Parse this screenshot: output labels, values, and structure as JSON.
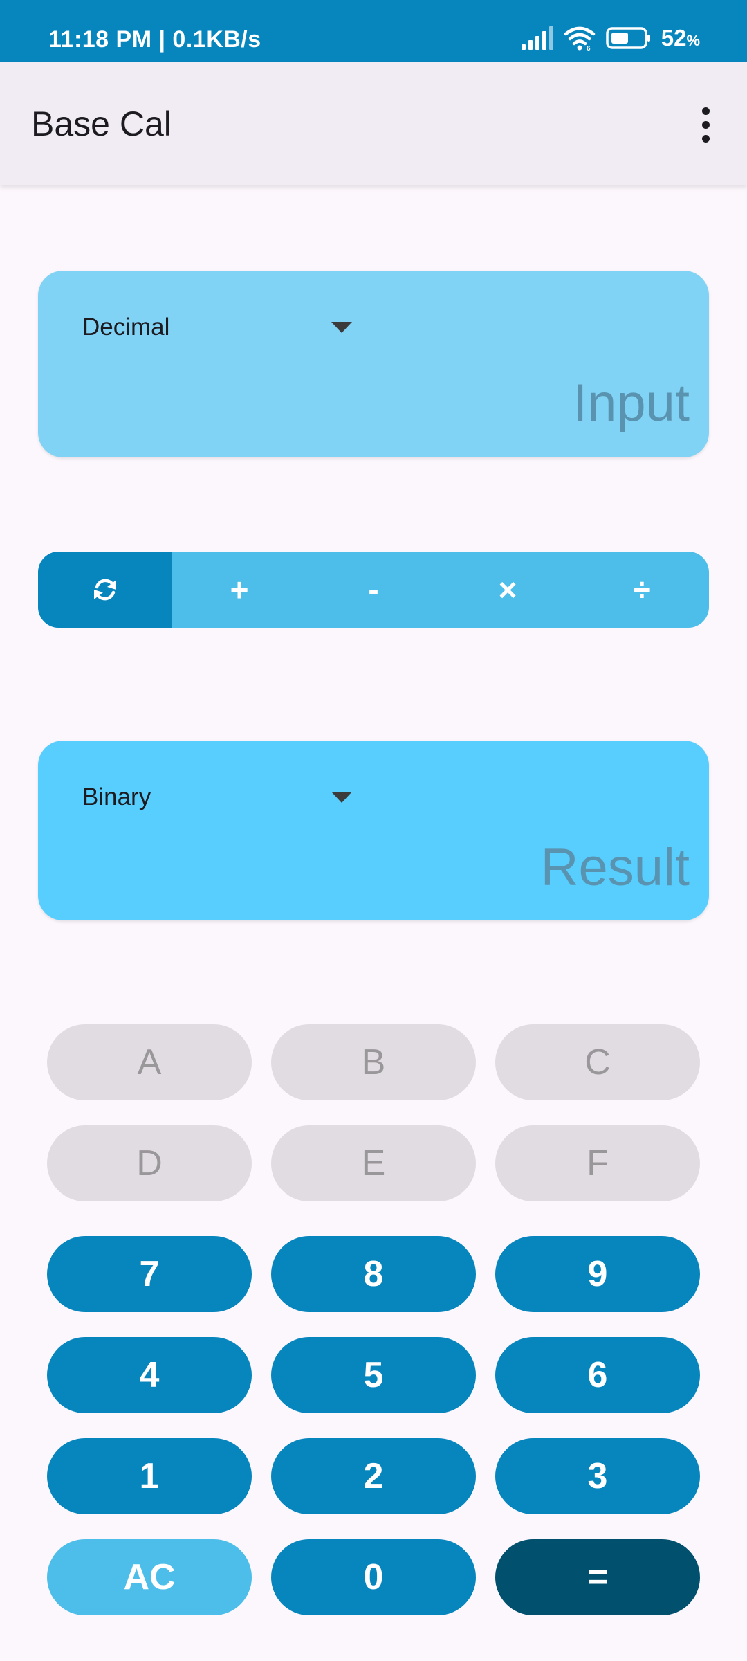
{
  "status_bar": {
    "time_speed": "11:18 PM | 0.1KB/s",
    "battery_percent": "52",
    "battery_unit": "%",
    "icons": [
      "signal-icon",
      "wifi-icon",
      "battery-icon"
    ]
  },
  "app_bar": {
    "title": "Base Cal",
    "overflow_icon": "more-vert-icon"
  },
  "input_card": {
    "base_selected": "Decimal",
    "placeholder": "Input"
  },
  "operations": {
    "items": [
      {
        "label": "⟳",
        "icon": "convert-icon",
        "active": true
      },
      {
        "label": "+",
        "active": false
      },
      {
        "label": "-",
        "active": false
      },
      {
        "label": "×",
        "active": false
      },
      {
        "label": "÷",
        "active": false
      }
    ]
  },
  "result_card": {
    "base_selected": "Binary",
    "placeholder": "Result"
  },
  "keypad": {
    "rows": [
      [
        "A",
        "B",
        "C"
      ],
      [
        "D",
        "E",
        "F"
      ],
      [
        "7",
        "8",
        "9"
      ],
      [
        "4",
        "5",
        "6"
      ],
      [
        "1",
        "2",
        "3"
      ],
      [
        "AC",
        "0",
        "="
      ]
    ]
  },
  "colors": {
    "status_bar": "#0786be",
    "app_bar": "#f1ecf4",
    "input_card": "#80d3f5",
    "result_card": "#57cefe",
    "op_bar": "#4dbee9",
    "op_active": "#0786be",
    "hex_key": "#e1dce1",
    "num_key": "#0786be",
    "ac_key": "#4dbee9",
    "equals_key": "#01506e"
  }
}
